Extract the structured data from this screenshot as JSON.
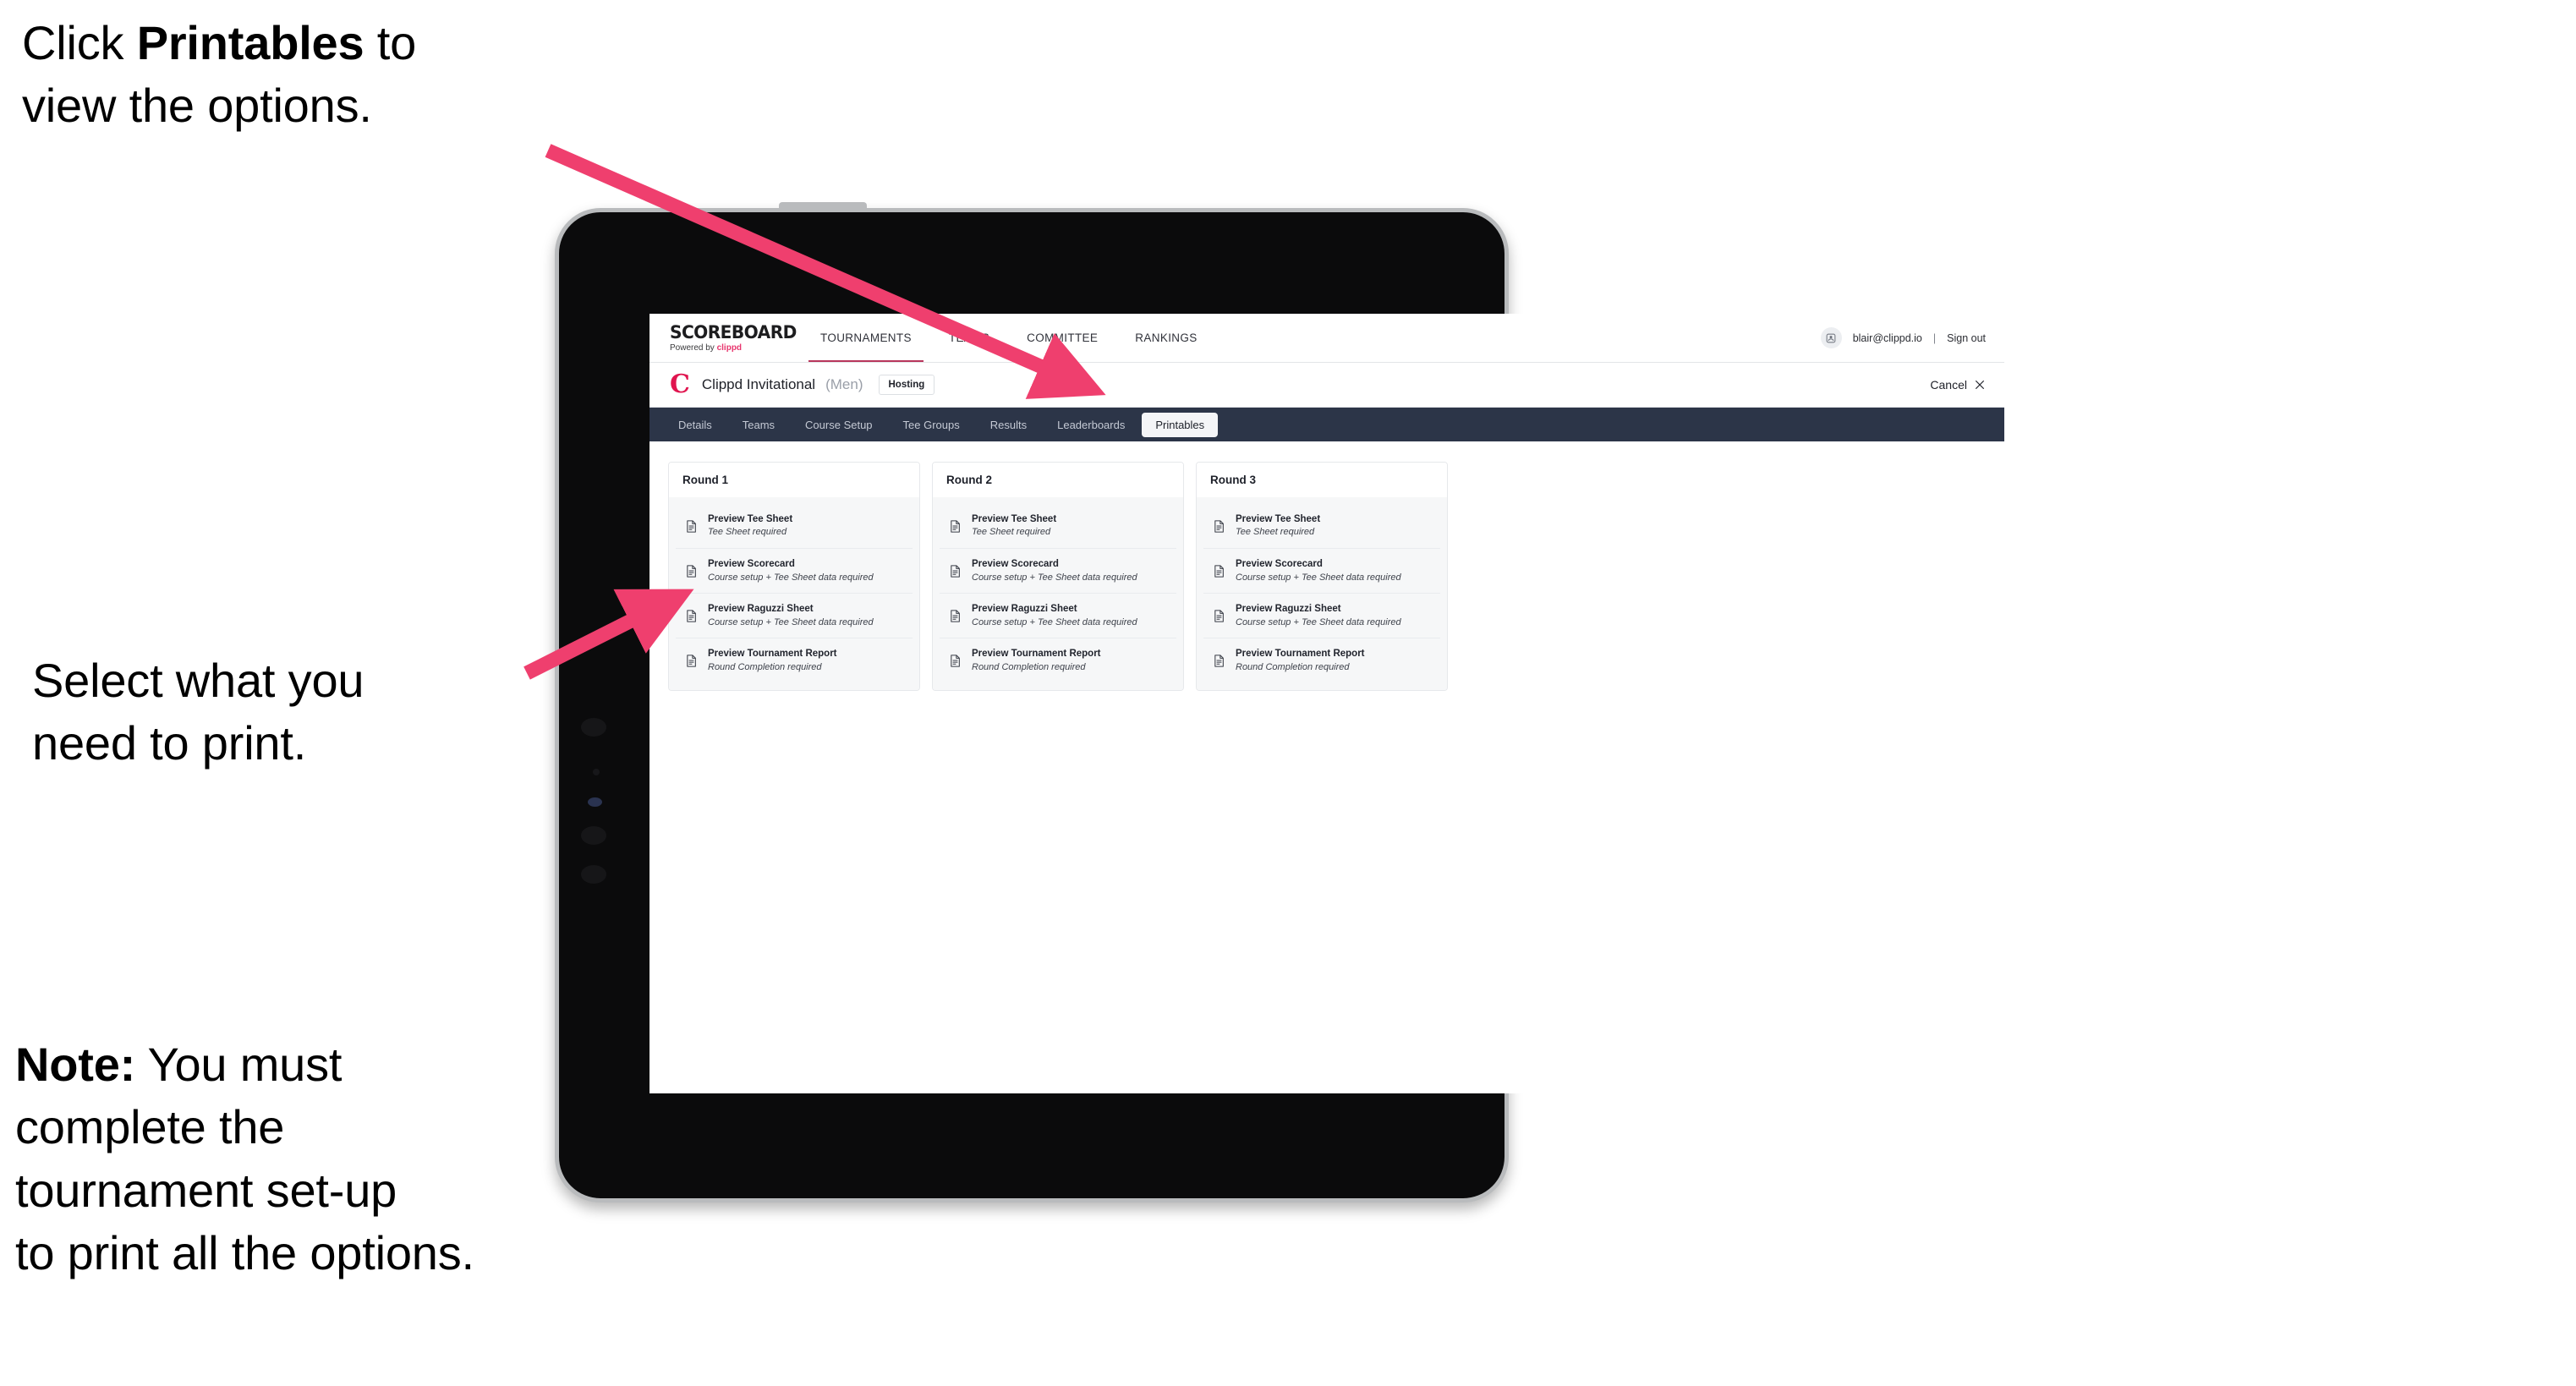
{
  "annotations": {
    "click_printables": "Click Printables to view the options.",
    "click_printables_bold": "Printables",
    "click_printables_pre": "Click ",
    "click_printables_post": " to\nview the options.",
    "select_print": "Select what you\n need to print.",
    "note_bold": "Note:",
    "note_rest": " You must\ncomplete the\ntournament set-up\nto print all the options.",
    "arrow_color": "#ef3f6e"
  },
  "app": {
    "brand": {
      "wordmark": "SCOREBOARD",
      "tagline_prefix": "Powered by ",
      "tagline_brand": "clippd"
    },
    "nav": [
      {
        "label": "TOURNAMENTS",
        "active": true
      },
      {
        "label": "TEAMS",
        "active": false
      },
      {
        "label": "COMMITTEE",
        "active": false
      },
      {
        "label": "RANKINGS",
        "active": false
      }
    ],
    "user": {
      "avatar_icon": "user-avatar-icon",
      "email": "blair@clippd.io",
      "separator": "|",
      "sign_out": "Sign out"
    },
    "tournament": {
      "logo_mark": "C",
      "name": "Clippd Invitational",
      "gender": "(Men)",
      "status_badge": "Hosting",
      "cancel_label": "Cancel",
      "cancel_icon": "close-icon"
    },
    "tabs": [
      {
        "label": "Details",
        "active": false
      },
      {
        "label": "Teams",
        "active": false
      },
      {
        "label": "Course Setup",
        "active": false
      },
      {
        "label": "Tee Groups",
        "active": false
      },
      {
        "label": "Results",
        "active": false
      },
      {
        "label": "Leaderboards",
        "active": false
      },
      {
        "label": "Printables",
        "active": true
      }
    ],
    "printables": {
      "rounds": [
        {
          "title": "Round 1",
          "items": [
            {
              "title": "Preview Tee Sheet",
              "requirement": "Tee Sheet required",
              "icon": "document-icon"
            },
            {
              "title": "Preview Scorecard",
              "requirement": "Course setup + Tee Sheet data required",
              "icon": "document-icon"
            },
            {
              "title": "Preview Raguzzi Sheet",
              "requirement": "Course setup + Tee Sheet data required",
              "icon": "document-icon"
            },
            {
              "title": "Preview Tournament Report",
              "requirement": "Round Completion required",
              "icon": "document-icon"
            }
          ]
        },
        {
          "title": "Round 2",
          "items": [
            {
              "title": "Preview Tee Sheet",
              "requirement": "Tee Sheet required",
              "icon": "document-icon"
            },
            {
              "title": "Preview Scorecard",
              "requirement": "Course setup + Tee Sheet data required",
              "icon": "document-icon"
            },
            {
              "title": "Preview Raguzzi Sheet",
              "requirement": "Course setup + Tee Sheet data required",
              "icon": "document-icon"
            },
            {
              "title": "Preview Tournament Report",
              "requirement": "Round Completion required",
              "icon": "document-icon"
            }
          ]
        },
        {
          "title": "Round 3",
          "items": [
            {
              "title": "Preview Tee Sheet",
              "requirement": "Tee Sheet required",
              "icon": "document-icon"
            },
            {
              "title": "Preview Scorecard",
              "requirement": "Course setup + Tee Sheet data required",
              "icon": "document-icon"
            },
            {
              "title": "Preview Raguzzi Sheet",
              "requirement": "Course setup + Tee Sheet data required",
              "icon": "document-icon"
            },
            {
              "title": "Preview Tournament Report",
              "requirement": "Round Completion required",
              "icon": "document-icon"
            }
          ]
        }
      ]
    },
    "colors": {
      "tab_strip_bg": "#2c3548",
      "nav_active_underline": "#b8365c",
      "brand_pink": "#e8356d",
      "clippd_mark": "#e0154f"
    }
  }
}
